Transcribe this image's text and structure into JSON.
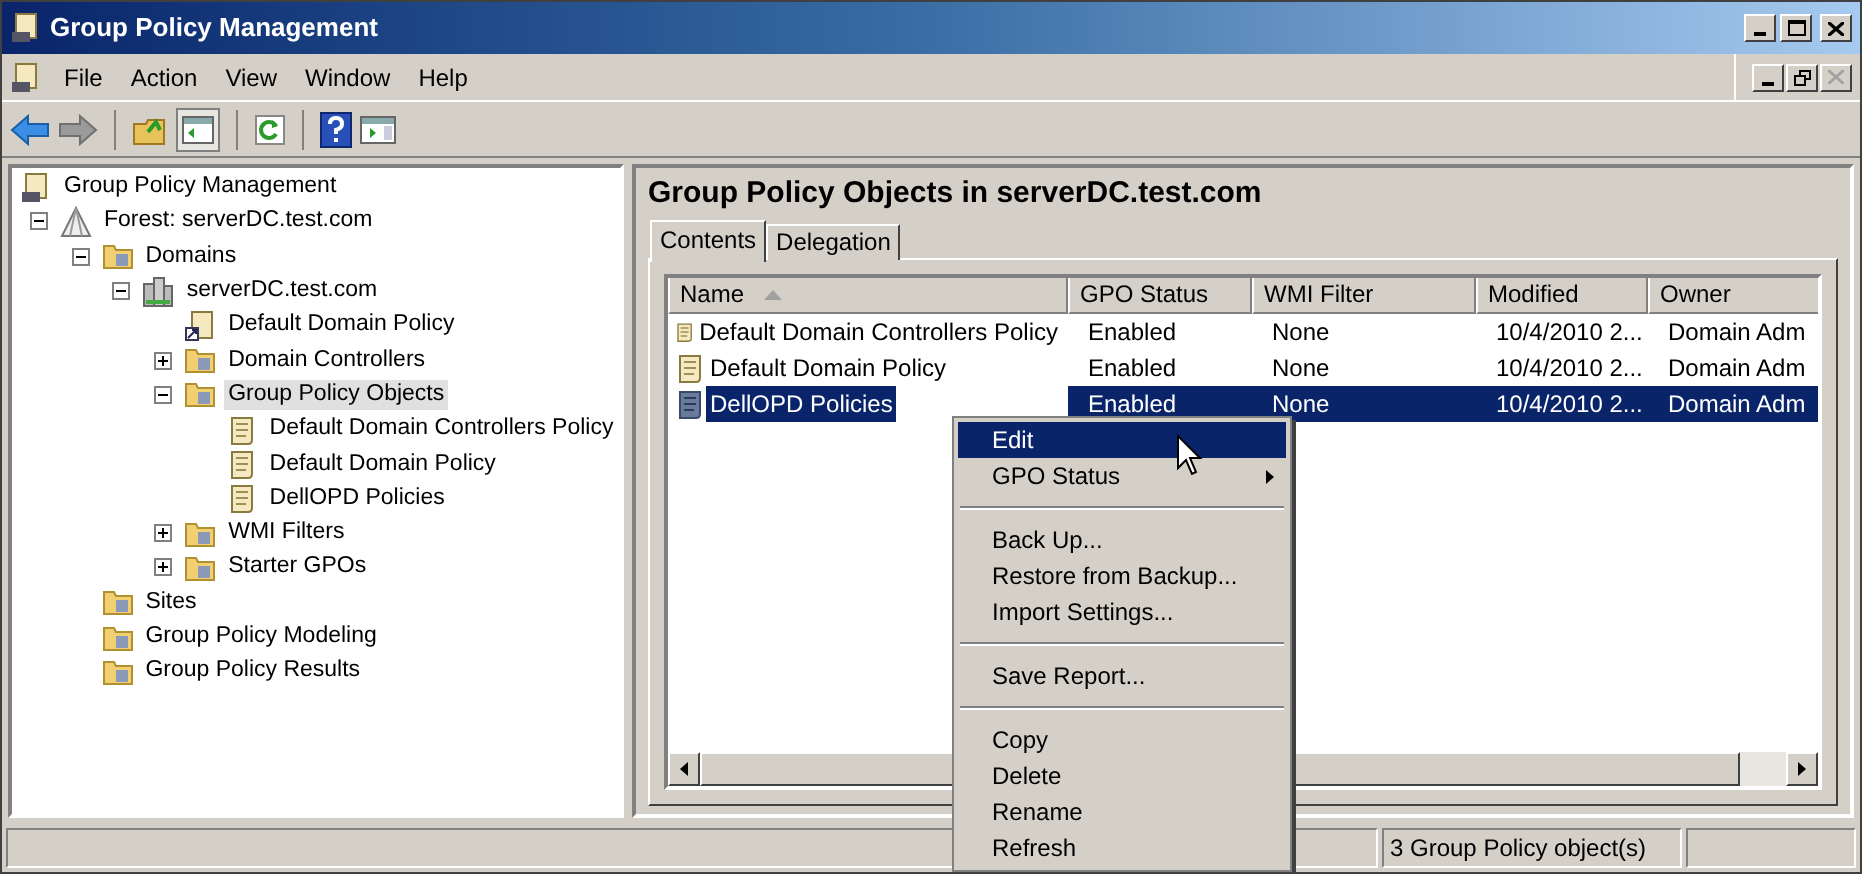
{
  "window": {
    "title": "Group Policy Management"
  },
  "menu": [
    "File",
    "Action",
    "View",
    "Window",
    "Help"
  ],
  "tree": [
    {
      "label": "Group Policy Management",
      "kind": "console",
      "selected": false,
      "children": [
        {
          "label": "Forest: serverDC.test.com",
          "kind": "forest",
          "selected": false,
          "expanded": true,
          "children": [
            {
              "label": "Domains",
              "kind": "folder",
              "selected": false,
              "expanded": true,
              "children": [
                {
                  "label": "serverDC.test.com",
                  "kind": "domain",
                  "selected": false,
                  "expanded": true,
                  "children": [
                    {
                      "label": "Default Domain Policy",
                      "kind": "link",
                      "selected": false
                    },
                    {
                      "label": "Domain Controllers",
                      "kind": "folder",
                      "selected": false,
                      "expanded": false
                    },
                    {
                      "label": "Group Policy Objects",
                      "kind": "folder",
                      "selected": true,
                      "expanded": true,
                      "children": [
                        {
                          "label": "Default Domain Controllers Policy",
                          "kind": "gpo",
                          "selected": false
                        },
                        {
                          "label": "Default Domain Policy",
                          "kind": "gpo",
                          "selected": false
                        },
                        {
                          "label": "DellOPD Policies",
                          "kind": "gpo",
                          "selected": false
                        }
                      ]
                    },
                    {
                      "label": "WMI Filters",
                      "kind": "folder",
                      "selected": false,
                      "expanded": false
                    },
                    {
                      "label": "Starter GPOs",
                      "kind": "folder",
                      "selected": false,
                      "expanded": false
                    }
                  ]
                }
              ]
            },
            {
              "label": "Sites",
              "kind": "folder",
              "selected": false
            },
            {
              "label": "Group Policy Modeling",
              "kind": "folder",
              "selected": false
            },
            {
              "label": "Group Policy Results",
              "kind": "folder",
              "selected": false
            }
          ]
        }
      ]
    }
  ],
  "content": {
    "heading": "Group Policy Objects in serverDC.test.com",
    "tabs": [
      {
        "label": "Contents",
        "selected": true
      },
      {
        "label": "Delegation",
        "selected": false
      }
    ],
    "table": {
      "columns": [
        "Name",
        "GPO Status",
        "WMI Filter",
        "Modified",
        "Owner"
      ],
      "rows": [
        {
          "cells": [
            "Default Domain Controllers Policy",
            "Enabled",
            "None",
            "10/4/2010 2...",
            "Domain Adm"
          ],
          "selected": false
        },
        {
          "cells": [
            "Default Domain Policy",
            "Enabled",
            "None",
            "10/4/2010 2...",
            "Domain Adm"
          ],
          "selected": false
        },
        {
          "cells": [
            "DellOPD Policies",
            "Enabled",
            "None",
            "10/4/2010 2...",
            "Domain Adm"
          ],
          "selected": true
        }
      ]
    }
  },
  "context_menu": [
    [
      {
        "label": "Edit",
        "selected": true
      },
      {
        "label": "GPO Status",
        "selected": false,
        "submenu": true
      }
    ],
    [
      {
        "label": "Back Up...",
        "selected": false
      },
      {
        "label": "Restore from Backup...",
        "selected": false
      },
      {
        "label": "Import Settings...",
        "selected": false
      }
    ],
    [
      {
        "label": "Save Report...",
        "selected": false
      }
    ],
    [
      {
        "label": "Copy",
        "selected": false
      },
      {
        "label": "Delete",
        "selected": false
      },
      {
        "label": "Rename",
        "selected": false
      },
      {
        "label": "Refresh",
        "selected": false
      }
    ]
  ],
  "status_bar": {
    "text": "3 Group Policy object(s)"
  }
}
